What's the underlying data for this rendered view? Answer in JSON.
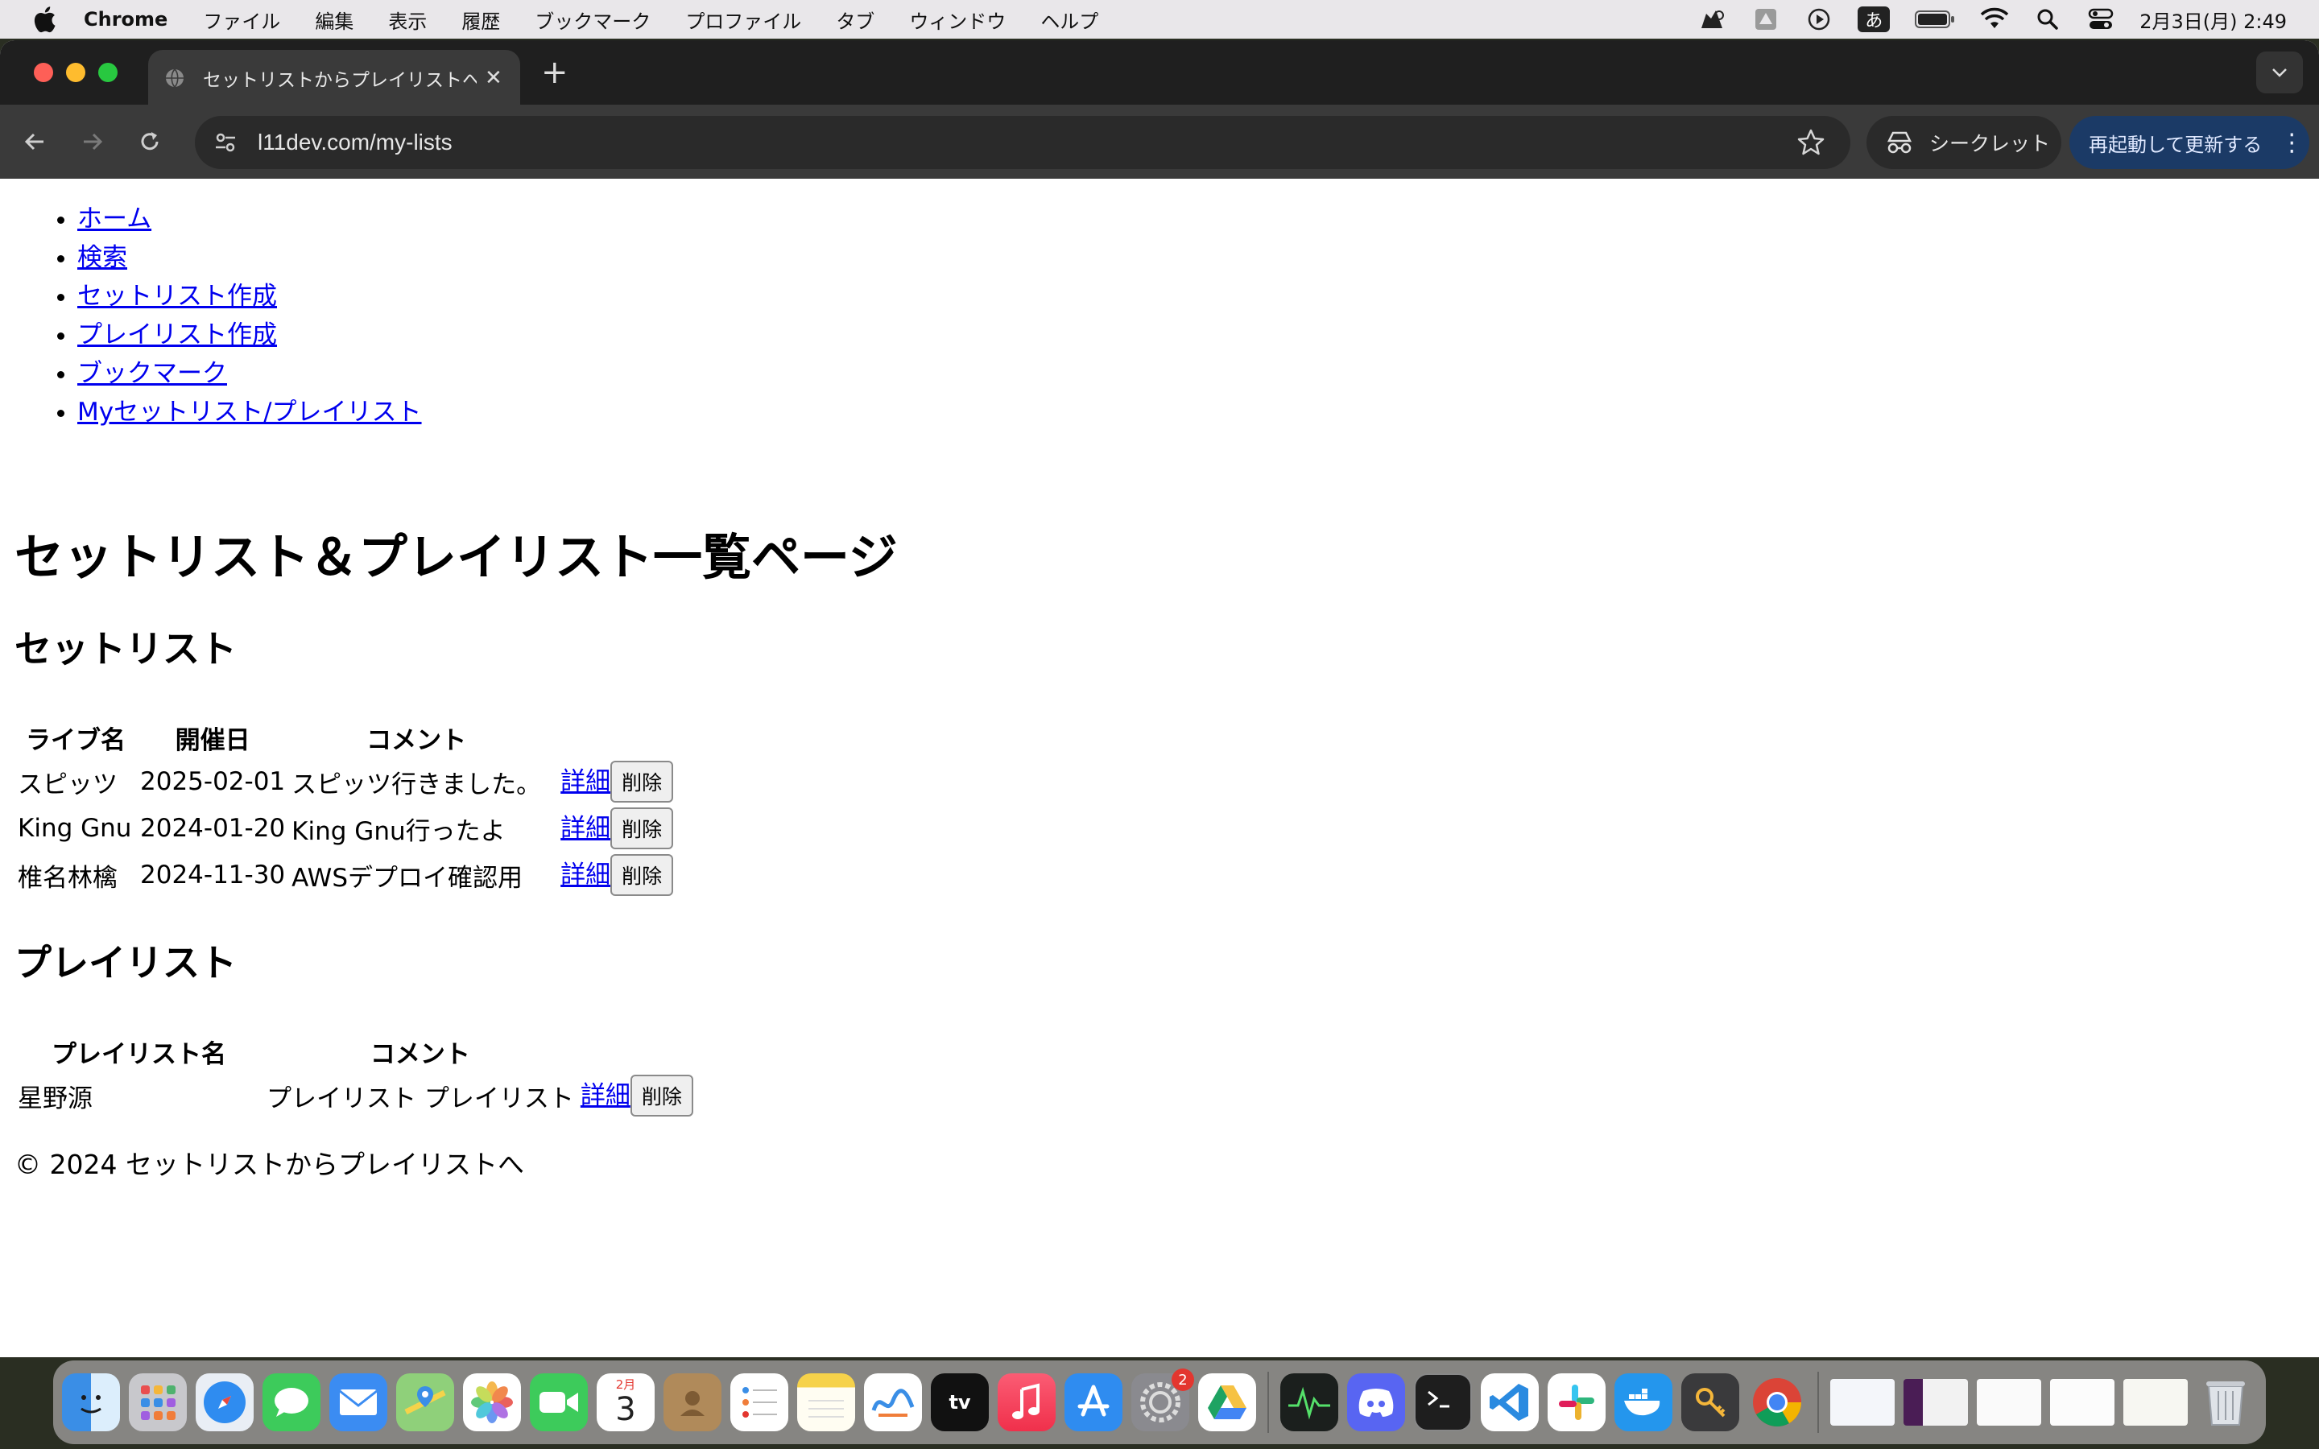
{
  "menubar": {
    "app_name": "Chrome",
    "items": [
      "ファイル",
      "編集",
      "表示",
      "履歴",
      "ブックマーク",
      "プロファイル",
      "タブ",
      "ウィンドウ",
      "ヘルプ"
    ],
    "input_mode": "あ",
    "datetime": "2月3日(月) 2:49"
  },
  "browser": {
    "tab_title": "セットリストからプレイリストへ",
    "url": "l11dev.com/my-lists",
    "incognito_label": "シークレット",
    "relaunch_label": "再起動して更新する"
  },
  "page": {
    "nav": [
      "ホーム",
      "検索",
      "セットリスト作成",
      "プレイリスト作成",
      "ブックマーク",
      "Myセットリスト/プレイリスト"
    ],
    "title": "セットリスト＆プレイリスト一覧ページ",
    "setlists": {
      "heading": "セットリスト",
      "columns": [
        "ライブ名",
        "開催日",
        "コメント"
      ],
      "rows": [
        {
          "name": "スピッツ",
          "date": "2025-02-01",
          "comment": "スピッツ行きました。",
          "detail": "詳細",
          "delete": "削除"
        },
        {
          "name": "King Gnu",
          "date": "2024-01-20",
          "comment": "King Gnu行ったよ",
          "detail": "詳細",
          "delete": "削除"
        },
        {
          "name": "椎名林檎",
          "date": "2024-11-30",
          "comment": "AWSデプロイ確認用",
          "detail": "詳細",
          "delete": "削除"
        }
      ]
    },
    "playlists": {
      "heading": "プレイリスト",
      "columns": [
        "プレイリスト名",
        "コメント"
      ],
      "rows": [
        {
          "name": "星野源",
          "comment": "プレイリスト プレイリスト",
          "detail": "詳細",
          "delete": "削除"
        }
      ]
    },
    "footer": "© 2024 セットリストからプレイリストへ"
  },
  "dock": {
    "calendar_month": "2月",
    "calendar_day": "3",
    "settings_badge": "2"
  }
}
